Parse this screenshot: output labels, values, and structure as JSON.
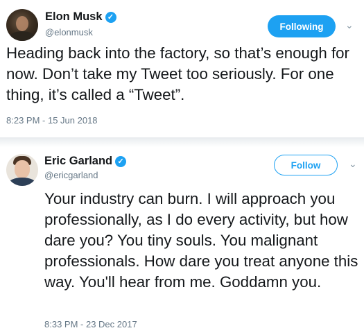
{
  "tweet1": {
    "name": "Elon Musk",
    "handle": "@elonmusk",
    "follow_label": "Following",
    "text": "Heading back into the factory, so that’s enough for now. Don’t take my Tweet too seriously. For one thing, it’s called a “Tweet”.",
    "timestamp": "8:23 PM - 15 Jun 2018"
  },
  "tweet2": {
    "name": "Eric Garland",
    "handle": "@ericgarland",
    "follow_label": "Follow",
    "text": "Your industry can burn. I will approach you professionally, as I do every activity, but how dare you? You tiny souls. You malignant professionals. How dare you treat anyone this way. You'll hear from me. Goddamn you.",
    "timestamp": "8:33 PM - 23 Dec 2017"
  },
  "icons": {
    "verified": "verified-badge-icon",
    "chevron": "chevron-down-icon"
  },
  "colors": {
    "accent": "#1da1f2",
    "text": "#14171a",
    "muted": "#657786"
  }
}
